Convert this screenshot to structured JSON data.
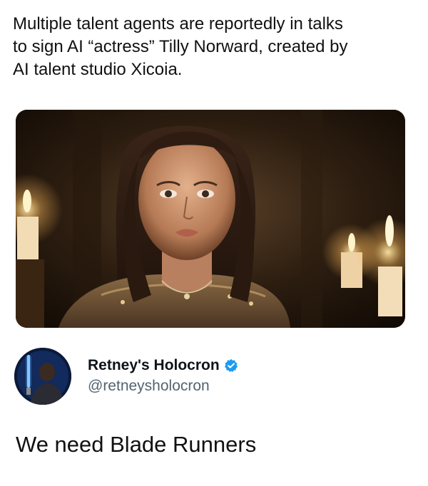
{
  "quoted_post": {
    "text_lines": [
      "Multiple talent agents are reportedly in talks",
      "to sign AI “actress” Tilly Norward, created by",
      "AI talent studio Xicoia."
    ]
  },
  "media": {
    "icon": "photo-of-woman-with-candles"
  },
  "author": {
    "display_name": "Retney's Holocron",
    "handle": "@retneysholocron",
    "verified_icon": "verified-badge-icon",
    "verified_color": "#1d9bf0",
    "avatar_icon": "lightsaber-figure-avatar"
  },
  "post": {
    "text": "We need Blade Runners"
  }
}
